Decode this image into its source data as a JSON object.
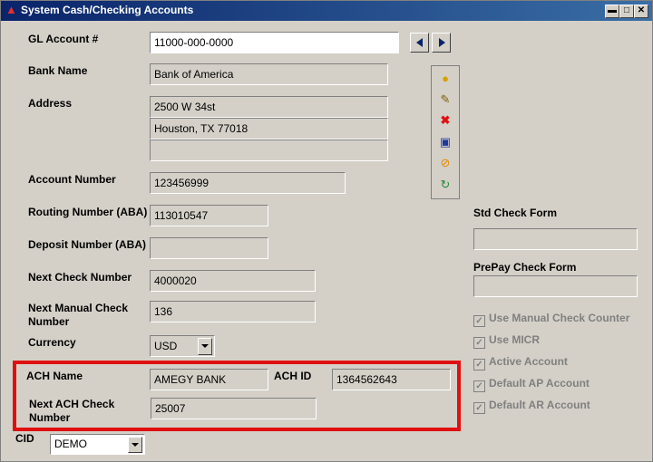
{
  "window": {
    "title": "System Cash/Checking Accounts",
    "controls": [
      "minimize",
      "maximize",
      "close"
    ]
  },
  "form": {
    "gl_account": {
      "label": "GL Account #",
      "value": "11000-000-0000"
    },
    "bank_name": {
      "label": "Bank Name",
      "value": "Bank of America"
    },
    "address": {
      "label": "Address",
      "line1": "2500 W 34st",
      "line2": "Houston, TX 77018",
      "line3": ""
    },
    "account_number": {
      "label": "Account Number",
      "value": "123456999"
    },
    "routing_number": {
      "label": "Routing Number (ABA)",
      "value": "113010547"
    },
    "deposit_number": {
      "label": "Deposit Number (ABA)",
      "value": ""
    },
    "next_check": {
      "label": "Next Check Number",
      "value": "4000020"
    },
    "next_manual_check": {
      "label_line1": "Next Manual Check",
      "label_line2": "Number",
      "value": "136"
    },
    "currency": {
      "label": "Currency",
      "value": "USD"
    },
    "ach_name": {
      "label": "ACH Name",
      "value": "AMEGY BANK"
    },
    "ach_id": {
      "label": "ACH ID",
      "value": "1364562643"
    },
    "next_ach_check": {
      "label_line1": "Next ACH Check",
      "label_line2": "Number",
      "value": "25007"
    },
    "cid": {
      "label": "CID",
      "value": "DEMO"
    }
  },
  "right_panel": {
    "std_check_form": {
      "label": "Std Check Form",
      "value": ""
    },
    "prepay_check_form": {
      "label": "PrePay Check Form",
      "value": ""
    },
    "checkboxes": [
      {
        "label": "Use Manual Check Counter",
        "checked": true
      },
      {
        "label": "Use MICR",
        "checked": true
      },
      {
        "label": "Active Account",
        "checked": true
      },
      {
        "label": "Default AP Account",
        "checked": true
      },
      {
        "label": "Default AR Account",
        "checked": true
      }
    ]
  },
  "toolbar": {
    "icons": [
      "new-record-icon",
      "edit-icon",
      "delete-icon",
      "save-icon",
      "cancel-icon",
      "refresh-icon"
    ]
  },
  "colors": {
    "titlebar_start": "#0a246a",
    "titlebar_end": "#3a6ea5",
    "highlight_frame": "#e01010",
    "window_bg": "#d4d0c8"
  }
}
